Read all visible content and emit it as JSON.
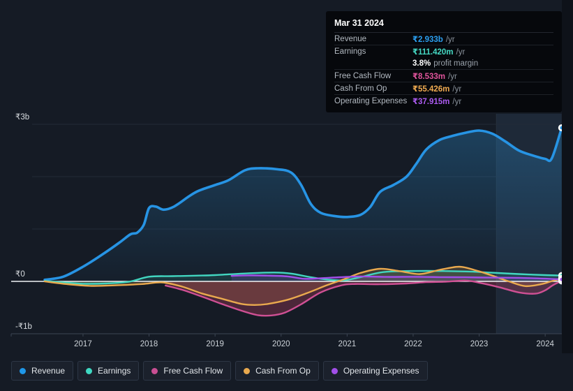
{
  "tooltip": {
    "date": "Mar 31 2024",
    "rows": [
      {
        "key": "revenue",
        "label": "Revenue",
        "value": "₹2.933b",
        "suffix": "/yr",
        "color": "#2b9ff0"
      },
      {
        "key": "earnings",
        "label": "Earnings",
        "value": "₹111.420m",
        "suffix": "/yr",
        "color": "#45d9c4"
      },
      {
        "key": "profit-margin",
        "type": "margin",
        "bold": "3.8%",
        "text": "profit margin"
      },
      {
        "key": "free-cash-flow",
        "label": "Free Cash Flow",
        "value": "₹8.533m",
        "suffix": "/yr",
        "color": "#e0549c"
      },
      {
        "key": "cash-from-op",
        "label": "Cash From Op",
        "value": "₹55.426m",
        "suffix": "/yr",
        "color": "#f0ab51"
      },
      {
        "key": "operating-expenses",
        "label": "Operating Expenses",
        "value": "₹37.915m",
        "suffix": "/yr",
        "color": "#ab5bf0"
      }
    ]
  },
  "legend": {
    "items": [
      {
        "key": "revenue",
        "label": "Revenue",
        "color": "#1f97e8"
      },
      {
        "key": "earnings",
        "label": "Earnings",
        "color": "#3fd8c2"
      },
      {
        "key": "free-cash-flow",
        "label": "Free Cash Flow",
        "color": "#c94f93"
      },
      {
        "key": "cash-from-op",
        "label": "Cash From Op",
        "color": "#e9a94e"
      },
      {
        "key": "operating-expenses",
        "label": "Operating Expenses",
        "color": "#a14fe8"
      }
    ]
  },
  "chart_data": {
    "type": "area",
    "unit": "₹ billions per year (trailing twelve months)",
    "x_axis": {
      "tick_years": [
        2017,
        2018,
        2019,
        2020,
        2021,
        2022,
        2023,
        2024
      ],
      "data_range": [
        2016.42,
        2024.25
      ]
    },
    "y_axis": {
      "range": [
        -1.0,
        3.2
      ],
      "gridline_values": [
        3,
        2,
        1
      ],
      "labels": [
        {
          "value": 3,
          "label": "₹3b"
        },
        {
          "value": 0,
          "label": "₹0"
        },
        {
          "value": -1,
          "label": "-₹1b"
        }
      ]
    },
    "highlight_band": {
      "x_start": 2023.26,
      "x_end": 2024.25
    },
    "zero_line_color": "#f2f4f6",
    "gridline_color": "#232b37",
    "axis_line_color": "#3c4553",
    "axis_text_color": "#ccd2d8",
    "band_color": "rgba(115,170,225,0.10)",
    "series": [
      {
        "name": "Revenue",
        "key": "revenue",
        "color": "#2794e4",
        "width": 3.6,
        "fill": {
          "type": "gradient",
          "top": "rgba(41,130,190,0.40)",
          "bottom": "rgba(41,130,190,0.04)"
        },
        "points": [
          [
            2016.42,
            0.03
          ],
          [
            2016.7,
            0.09
          ],
          [
            2017.0,
            0.28
          ],
          [
            2017.3,
            0.52
          ],
          [
            2017.55,
            0.74
          ],
          [
            2017.72,
            0.9
          ],
          [
            2017.82,
            0.93
          ],
          [
            2017.92,
            1.08
          ],
          [
            2018.0,
            1.4
          ],
          [
            2018.1,
            1.43
          ],
          [
            2018.22,
            1.37
          ],
          [
            2018.38,
            1.43
          ],
          [
            2018.6,
            1.62
          ],
          [
            2018.75,
            1.73
          ],
          [
            2019.0,
            1.84
          ],
          [
            2019.2,
            1.93
          ],
          [
            2019.45,
            2.12
          ],
          [
            2019.65,
            2.16
          ],
          [
            2019.95,
            2.14
          ],
          [
            2020.15,
            2.08
          ],
          [
            2020.3,
            1.85
          ],
          [
            2020.45,
            1.48
          ],
          [
            2020.6,
            1.31
          ],
          [
            2020.8,
            1.25
          ],
          [
            2021.0,
            1.23
          ],
          [
            2021.2,
            1.27
          ],
          [
            2021.35,
            1.42
          ],
          [
            2021.5,
            1.71
          ],
          [
            2021.7,
            1.84
          ],
          [
            2021.9,
            2.0
          ],
          [
            2022.05,
            2.25
          ],
          [
            2022.2,
            2.52
          ],
          [
            2022.4,
            2.7
          ],
          [
            2022.6,
            2.78
          ],
          [
            2022.8,
            2.84
          ],
          [
            2023.0,
            2.88
          ],
          [
            2023.2,
            2.82
          ],
          [
            2023.4,
            2.67
          ],
          [
            2023.6,
            2.5
          ],
          [
            2023.8,
            2.41
          ],
          [
            2024.0,
            2.34
          ],
          [
            2024.1,
            2.35
          ],
          [
            2024.25,
            2.933
          ]
        ]
      },
      {
        "name": "Earnings",
        "key": "earnings",
        "color": "#42d6c0",
        "width": 2.4,
        "fill": {
          "type": "flat",
          "color": "rgba(64,213,189,0.14)"
        },
        "points": [
          [
            2016.42,
            0.01
          ],
          [
            2016.7,
            -0.02
          ],
          [
            2017.0,
            -0.045
          ],
          [
            2017.35,
            -0.04
          ],
          [
            2017.7,
            -0.005
          ],
          [
            2018.0,
            0.09
          ],
          [
            2018.35,
            0.1
          ],
          [
            2018.7,
            0.11
          ],
          [
            2019.0,
            0.12
          ],
          [
            2019.5,
            0.155
          ],
          [
            2019.9,
            0.17
          ],
          [
            2020.15,
            0.15
          ],
          [
            2020.45,
            0.08
          ],
          [
            2020.7,
            0.035
          ],
          [
            2020.95,
            0.02
          ],
          [
            2021.2,
            0.08
          ],
          [
            2021.5,
            0.17
          ],
          [
            2021.8,
            0.195
          ],
          [
            2022.2,
            0.2
          ],
          [
            2022.6,
            0.195
          ],
          [
            2022.9,
            0.185
          ],
          [
            2023.2,
            0.165
          ],
          [
            2023.6,
            0.14
          ],
          [
            2024.0,
            0.12
          ],
          [
            2024.25,
            0.1114
          ]
        ]
      },
      {
        "name": "Cash From Op",
        "key": "cash-from-op",
        "color": "#e9a94e",
        "width": 2.4,
        "fill": {
          "type": "flat",
          "color": "rgba(230,165,75,0.20)"
        },
        "points": [
          [
            2016.42,
            0.0
          ],
          [
            2016.7,
            -0.045
          ],
          [
            2017.1,
            -0.085
          ],
          [
            2017.5,
            -0.075
          ],
          [
            2017.9,
            -0.05
          ],
          [
            2018.2,
            -0.02
          ],
          [
            2018.5,
            -0.1
          ],
          [
            2018.8,
            -0.23
          ],
          [
            2019.1,
            -0.33
          ],
          [
            2019.4,
            -0.43
          ],
          [
            2019.6,
            -0.45
          ],
          [
            2019.8,
            -0.43
          ],
          [
            2020.1,
            -0.35
          ],
          [
            2020.4,
            -0.22
          ],
          [
            2020.7,
            -0.07
          ],
          [
            2020.95,
            0.04
          ],
          [
            2021.2,
            0.16
          ],
          [
            2021.5,
            0.24
          ],
          [
            2021.8,
            0.195
          ],
          [
            2022.1,
            0.14
          ],
          [
            2022.4,
            0.22
          ],
          [
            2022.7,
            0.28
          ],
          [
            2022.95,
            0.21
          ],
          [
            2023.2,
            0.11
          ],
          [
            2023.45,
            0.0
          ],
          [
            2023.7,
            -0.09
          ],
          [
            2023.95,
            -0.05
          ],
          [
            2024.1,
            0.005
          ],
          [
            2024.25,
            0.0554
          ]
        ]
      },
      {
        "name": "Free Cash Flow",
        "key": "free-cash-flow",
        "color": "#cf5094",
        "width": 2.4,
        "fill": {
          "type": "flat",
          "color": "rgba(205,70,105,0.30)"
        },
        "points": [
          [
            2018.25,
            -0.08
          ],
          [
            2018.5,
            -0.16
          ],
          [
            2018.8,
            -0.29
          ],
          [
            2019.1,
            -0.43
          ],
          [
            2019.4,
            -0.56
          ],
          [
            2019.65,
            -0.645
          ],
          [
            2019.85,
            -0.65
          ],
          [
            2020.05,
            -0.6
          ],
          [
            2020.3,
            -0.44
          ],
          [
            2020.6,
            -0.21
          ],
          [
            2020.9,
            -0.08
          ],
          [
            2021.1,
            -0.05
          ],
          [
            2021.5,
            -0.055
          ],
          [
            2021.9,
            -0.04
          ],
          [
            2022.2,
            -0.015
          ],
          [
            2022.5,
            -0.005
          ],
          [
            2022.8,
            0.015
          ],
          [
            2023.0,
            -0.025
          ],
          [
            2023.3,
            -0.11
          ],
          [
            2023.6,
            -0.21
          ],
          [
            2023.85,
            -0.235
          ],
          [
            2024.0,
            -0.17
          ],
          [
            2024.12,
            -0.07
          ],
          [
            2024.25,
            0.0085
          ]
        ]
      },
      {
        "name": "Operating Expenses",
        "key": "operating-expenses",
        "color": "#a14fe8",
        "width": 2.4,
        "fill": {
          "type": "flat",
          "color": "rgba(160,85,230,0.18)"
        },
        "points": [
          [
            2019.25,
            0.105
          ],
          [
            2019.5,
            0.115
          ],
          [
            2019.8,
            0.11
          ],
          [
            2020.1,
            0.095
          ],
          [
            2020.35,
            0.05
          ],
          [
            2020.6,
            0.06
          ],
          [
            2020.9,
            0.08
          ],
          [
            2021.2,
            0.095
          ],
          [
            2021.6,
            0.085
          ],
          [
            2022.0,
            0.088
          ],
          [
            2022.4,
            0.082
          ],
          [
            2022.8,
            0.078
          ],
          [
            2023.2,
            0.072
          ],
          [
            2023.6,
            0.068
          ],
          [
            2024.0,
            0.052
          ],
          [
            2024.25,
            0.0379
          ]
        ]
      }
    ]
  }
}
